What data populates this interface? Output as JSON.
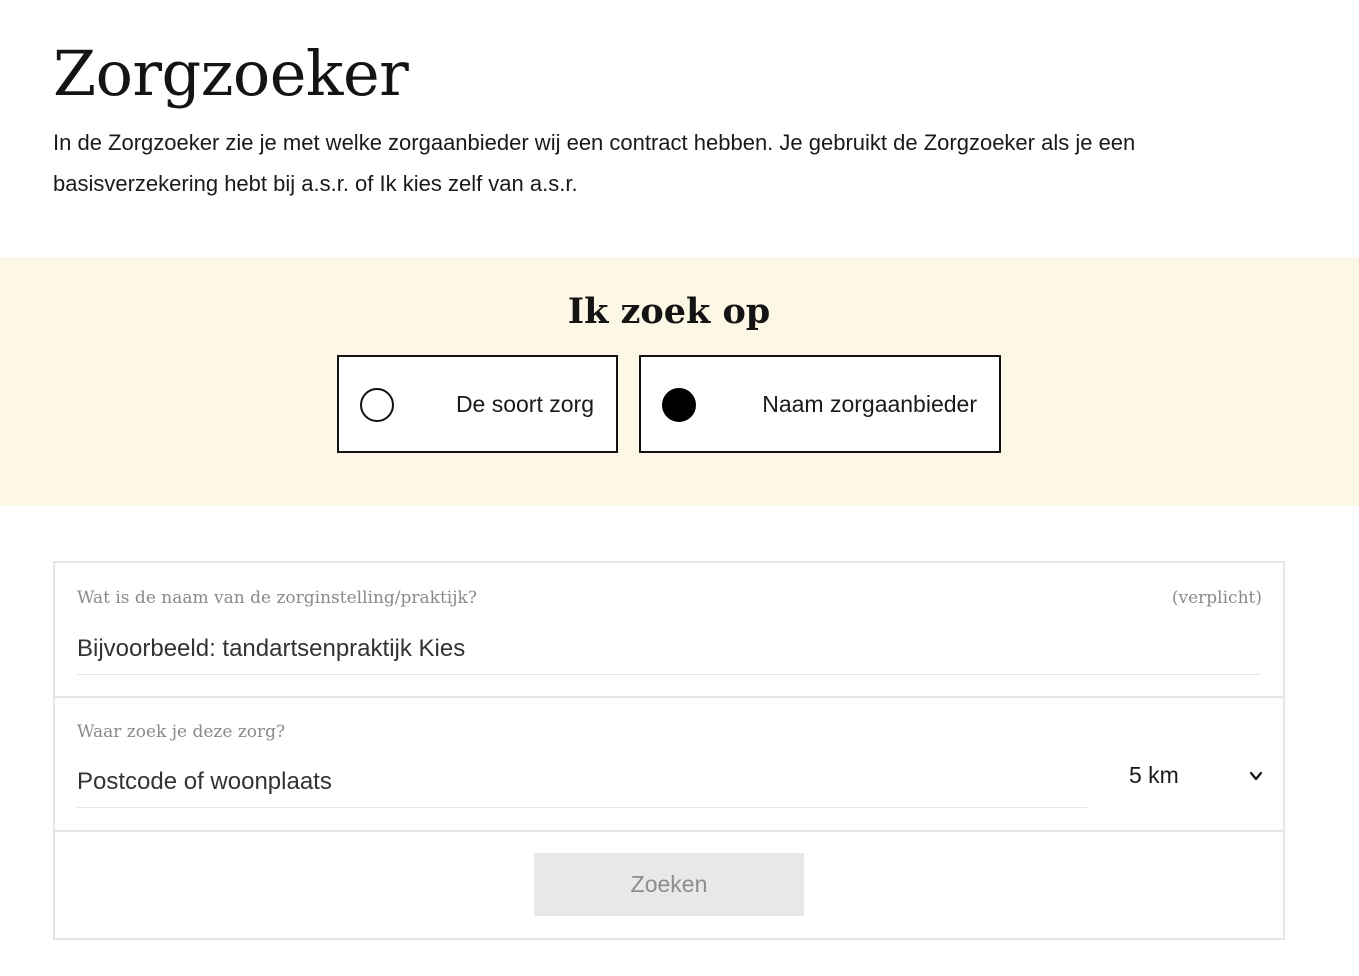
{
  "page": {
    "title": "Zorgzoeker",
    "intro": "In de Zorgzoeker zie je met welke zorgaanbieder wij een contract hebben. Je gebruikt de Zorgzoeker als je een basisverzekering hebt bij a.s.r. of Ik kies zelf van a.s.r."
  },
  "search_by": {
    "heading": "Ik zoek op",
    "options": [
      {
        "label": "De soort zorg",
        "selected": false
      },
      {
        "label": "Naam zorgaanbieder",
        "selected": true
      }
    ],
    "band_color": "#fdf8e6"
  },
  "form": {
    "name_field": {
      "label": "Wat is de naam van de zorginstelling/praktijk?",
      "required_label": "(verplicht)",
      "value": "",
      "placeholder": "Bijvoorbeeld: tandartsenpraktijk Kies"
    },
    "location_field": {
      "label": "Waar zoek je deze zorg?",
      "value": "",
      "placeholder": "Postcode of woonplaats"
    },
    "distance": {
      "selected": "5 km",
      "icon": "chevron-down-icon"
    },
    "submit": {
      "label": "Zoeken",
      "disabled": true
    }
  }
}
